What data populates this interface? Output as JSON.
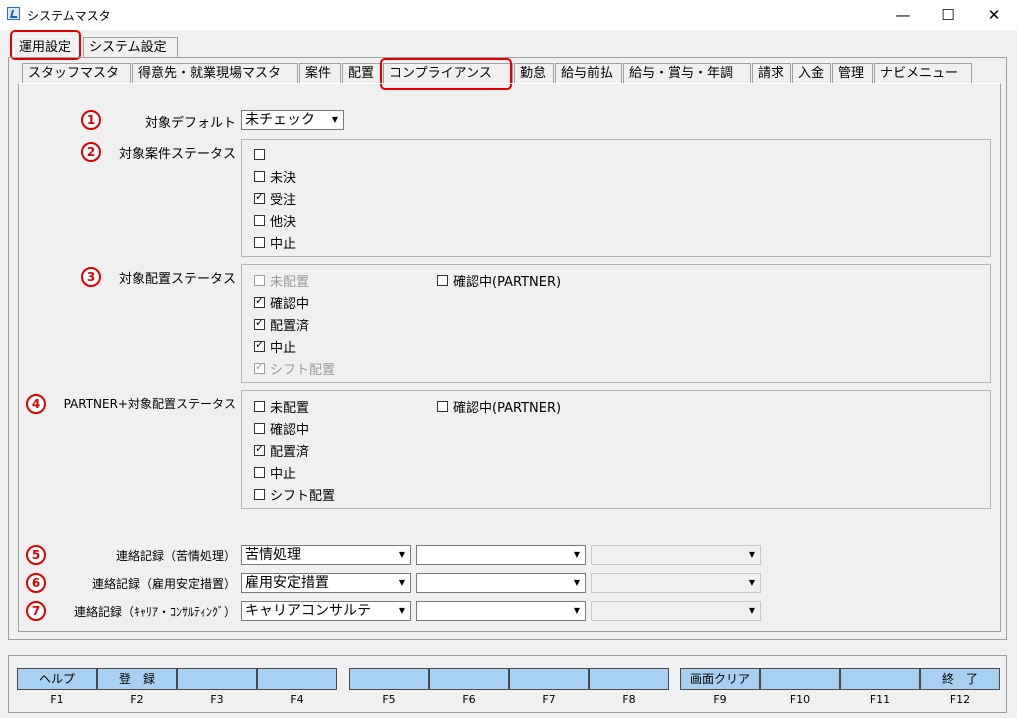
{
  "window": {
    "title": "システムマスタ",
    "minimize": "—",
    "maximize": "☐",
    "close": "✕"
  },
  "outer_tabs": [
    "運用設定",
    "システム設定"
  ],
  "inner_tabs": [
    "スタッフマスタ",
    "得意先・就業現場マスタ",
    "案件",
    "配置",
    "コンプライアンス",
    "勤怠",
    "給与前払",
    "給与・賞与・年調",
    "請求",
    "入金",
    "管理",
    "ナビメニュー"
  ],
  "badges": [
    "1",
    "2",
    "3",
    "4",
    "5",
    "6",
    "7"
  ],
  "fields": {
    "target_default": {
      "label": "対象デフォルト",
      "value": "未チェック"
    },
    "project_status": {
      "label": "対象案件ステータス",
      "items": [
        {
          "text": "",
          "checked": false
        },
        {
          "text": "未決",
          "checked": false
        },
        {
          "text": "受注",
          "checked": true
        },
        {
          "text": "他決",
          "checked": false
        },
        {
          "text": "中止",
          "checked": false
        }
      ]
    },
    "placement_status": {
      "label": "対象配置ステータス",
      "items": [
        {
          "text": "未配置",
          "checked": false,
          "disabled": true
        },
        {
          "text": "確認中",
          "checked": true
        },
        {
          "text": "配置済",
          "checked": true
        },
        {
          "text": "中止",
          "checked": true
        },
        {
          "text": "シフト配置",
          "checked": true,
          "disabled": true
        }
      ],
      "extra": {
        "text": "確認中(PARTNER)",
        "checked": false
      }
    },
    "partner_status": {
      "label": "PARTNER+対象配置ステータス",
      "items": [
        {
          "text": "未配置",
          "checked": false
        },
        {
          "text": "確認中",
          "checked": false
        },
        {
          "text": "配置済",
          "checked": true
        },
        {
          "text": "中止",
          "checked": false
        },
        {
          "text": "シフト配置",
          "checked": false
        }
      ],
      "extra": {
        "text": "確認中(PARTNER)",
        "checked": false
      }
    },
    "contact_complaint": {
      "label": "連絡記録（苦情処理）",
      "value": "苦情処理"
    },
    "contact_employment": {
      "label": "連絡記録（雇用安定措置）",
      "value": "雇用安定措置"
    },
    "contact_career": {
      "label": "連絡記録（ｷｬﾘｱ・ｺﾝｻﾙﾃｨﾝｸﾞ）",
      "value": "キャリアコンサルテ"
    }
  },
  "fbuttons": [
    {
      "label": "ヘルプ",
      "key": "F1"
    },
    {
      "label": "登　録",
      "key": "F2"
    },
    {
      "label": "",
      "key": "F3"
    },
    {
      "label": "",
      "key": "F4"
    },
    {
      "label": "",
      "key": "F5"
    },
    {
      "label": "",
      "key": "F6"
    },
    {
      "label": "",
      "key": "F7"
    },
    {
      "label": "",
      "key": "F8"
    },
    {
      "label": "画面クリア",
      "key": "F9"
    },
    {
      "label": "",
      "key": "F10"
    },
    {
      "label": "",
      "key": "F11"
    },
    {
      "label": "終　了",
      "key": "F12"
    }
  ],
  "colors": {
    "highlight": "#e00000",
    "fbutton": "#a7d0f2"
  }
}
